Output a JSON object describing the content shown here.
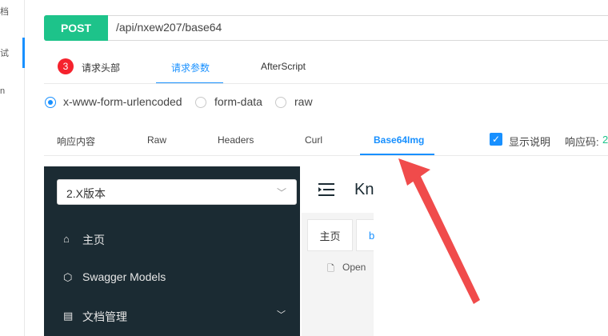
{
  "left_strip": {
    "items": [
      "档",
      "试",
      "n"
    ]
  },
  "request": {
    "method": "POST",
    "url": "/api/nxew207/base64"
  },
  "request_tabs": {
    "badge": "3",
    "headers": "请求头部",
    "params": "请求参数",
    "after": "AfterScript"
  },
  "body_types": {
    "urlencoded": "x-www-form-urlencoded",
    "formdata": "form-data",
    "raw": "raw"
  },
  "response_tabs": {
    "content": "响应内容",
    "raw": "Raw",
    "headers": "Headers",
    "curl": "Curl",
    "base64": "Base64Img"
  },
  "options": {
    "show_desc": "显示说明",
    "code_label": "响应码:",
    "code_value": "2"
  },
  "embed": {
    "version": "2.X版本",
    "brand": "Kn",
    "menu": {
      "home": "主页",
      "models": "Swagger Models",
      "docs": "文档管理"
    },
    "tabs": {
      "home": "主页",
      "b": "b"
    },
    "open": "Open"
  },
  "colors": {
    "method": "#1dc38a",
    "accent": "#1890ff",
    "badge": "#f5222d",
    "arrow": "#f04b4b",
    "sidebar": "#1b2b33"
  }
}
